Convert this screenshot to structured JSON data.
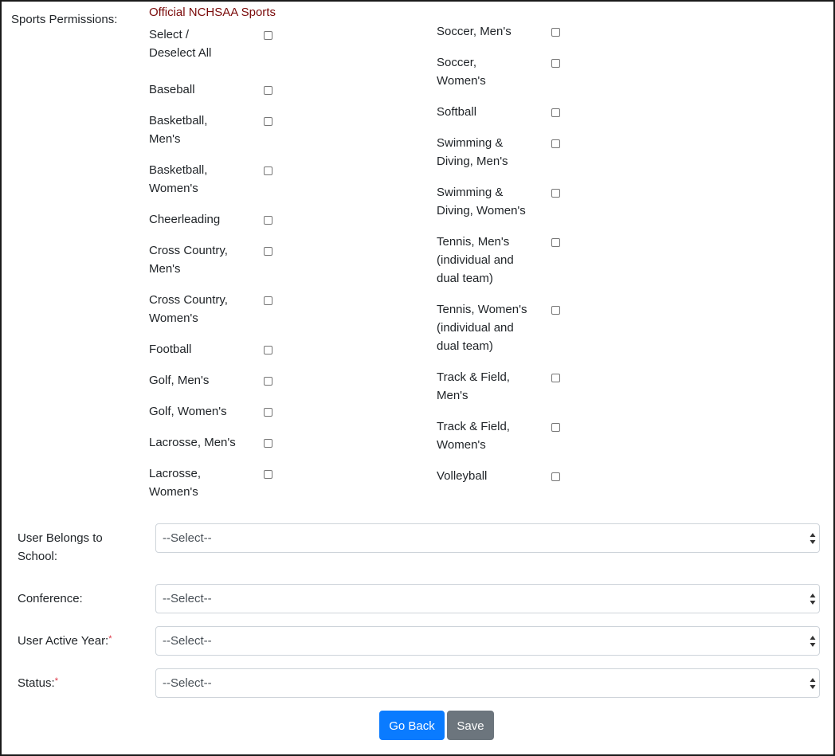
{
  "permissions": {
    "label": "Sports Permissions:",
    "section_title": "Official NCHSAA Sports",
    "select_all": [
      "Select /",
      "Deselect All"
    ],
    "left_sports": [
      [
        "Baseball"
      ],
      [
        "Basketball,",
        "Men's"
      ],
      [
        "Basketball,",
        "Women's"
      ],
      [
        "Cheerleading"
      ],
      [
        "Cross Country,",
        "Men's"
      ],
      [
        "Cross Country,",
        "Women's"
      ],
      [
        "Football"
      ],
      [
        "Golf, Men's"
      ],
      [
        "Golf, Women's"
      ],
      [
        "Lacrosse, Men's"
      ],
      [
        "Lacrosse,",
        "Women's"
      ]
    ],
    "right_sports": [
      [
        "Soccer, Men's"
      ],
      [
        "Soccer,",
        "Women's"
      ],
      [
        "Softball"
      ],
      [
        "Swimming &",
        "Diving, Men's"
      ],
      [
        "Swimming &",
        "Diving, Women's"
      ],
      [
        "Tennis, Men's",
        "(individual and",
        "dual team)"
      ],
      [
        "Tennis, Women's",
        "(individual and",
        "dual team)"
      ],
      [
        "Track & Field,",
        "Men's"
      ],
      [
        "Track & Field,",
        "Women's"
      ],
      [
        "Volleyball"
      ]
    ]
  },
  "form": {
    "school_label": [
      "User Belongs to",
      "School:"
    ],
    "school_value": "--Select--",
    "conference_label": "Conference:",
    "conference_value": "--Select--",
    "year_label": "User Active Year:",
    "year_value": "--Select--",
    "status_label": "Status:",
    "status_value": "--Select--",
    "required_mark": "*"
  },
  "buttons": {
    "back": "Go Back",
    "save": "Save"
  },
  "colors": {
    "section_title": "#7a0a0a",
    "primary": "#0a7bff",
    "secondary": "#6c757d",
    "required": "#dc3545"
  }
}
